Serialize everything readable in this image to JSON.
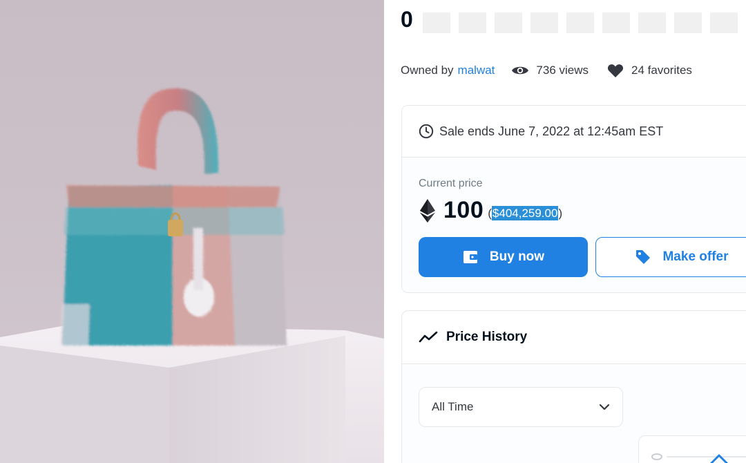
{
  "item": {
    "title": "0",
    "owner_prefix": "Owned by",
    "owner_name": "malwat",
    "views": "736 views",
    "favorites": "24 favorites"
  },
  "sale": {
    "ends_text": "Sale ends June 7, 2022 at 12:45am EST",
    "current_price_label": "Current price",
    "price": "100",
    "usd_open": "(",
    "usd_value": "$404,259.00",
    "usd_close": ")",
    "buy_label": "Buy now",
    "offer_label": "Make offer"
  },
  "price_history": {
    "title": "Price History",
    "range_selected": "All Time"
  },
  "icons": {
    "views": "eye-icon",
    "favorites": "heart-icon",
    "sale_end": "clock-icon",
    "currency": "ethereum-icon",
    "buy": "wallet-icon",
    "offer": "tag-icon",
    "history": "trend-line-icon",
    "dropdown": "chevron-down-icon"
  },
  "colors": {
    "accent": "#2081e2",
    "text": "#04111d",
    "muted": "#707a83",
    "border": "#e5e8eb"
  }
}
